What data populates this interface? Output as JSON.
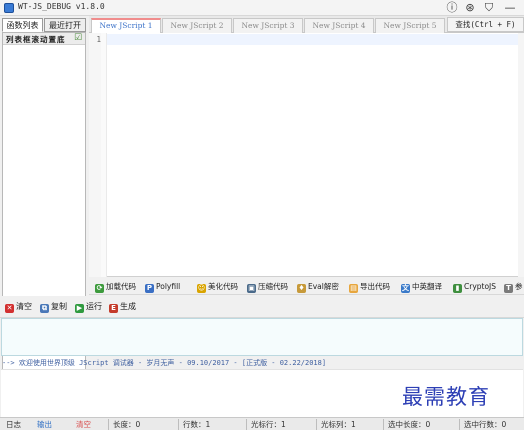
{
  "window": {
    "title": "WT-JS_DEBUG v1.8.0",
    "buttons": [
      "ⓘ",
      "⊛",
      "⛉",
      "—"
    ]
  },
  "left_panel": {
    "tabs": [
      "函数列表",
      "最近打开"
    ],
    "list_header": "列表框滚动置底",
    "list_header_check": "☑"
  },
  "script_tabs": [
    "New JScript 1",
    "New JScript 2",
    "New JScript 3",
    "New JScript 4",
    "New JScript 5"
  ],
  "find_button": "查找(Ctrl + F)",
  "editor": {
    "line_numbers": [
      "1"
    ]
  },
  "toolbar1": [
    {
      "label": "加载代码",
      "icon": "load-icon",
      "glyph": "⟳",
      "color": "#3c9a3c"
    },
    {
      "label": "Polyfill",
      "icon": "polyfill-icon",
      "glyph": "P",
      "color": "#3a6fc4"
    },
    {
      "label": "美化代码",
      "icon": "beautify-icon",
      "glyph": "☺",
      "color": "#d9a400"
    },
    {
      "label": "压缩代码",
      "icon": "compress-icon",
      "glyph": "▣",
      "color": "#4a6a8a"
    },
    {
      "label": "Eval解密",
      "icon": "eval-icon",
      "glyph": "♦",
      "color": "#c79a3a"
    },
    {
      "label": "导出代码",
      "icon": "export-icon",
      "glyph": "▤",
      "color": "#e7a63d"
    },
    {
      "label": "中英翻译",
      "icon": "translate-icon",
      "glyph": "文",
      "color": "#3a7ac9"
    },
    {
      "label": "CryptoJS",
      "icon": "cryptojs-icon",
      "glyph": "▮",
      "color": "#3f8f3f"
    },
    {
      "label": "参",
      "icon": "params-icon",
      "glyph": "T",
      "color": "#7a7a7a"
    }
  ],
  "toolbar2": [
    {
      "label": "清空",
      "icon": "clear-icon",
      "glyph": "✕",
      "color": "#d23030"
    },
    {
      "label": "复制",
      "icon": "copy-icon",
      "glyph": "⧉",
      "color": "#4a78b8"
    },
    {
      "label": "运行",
      "icon": "run-icon",
      "glyph": "▶",
      "color": "#2f9a3f"
    },
    {
      "label": "生成",
      "icon": "generate-icon",
      "glyph": "E",
      "color": "#c43a2a"
    }
  ],
  "output_message": "--> 欢迎使用世界顶级 JScript 调试器 - 岁月无声 - 09.10/2017 - [正式版 - 02.22/2018]",
  "watermark": "最需教育",
  "status_bar": {
    "tabs": [
      "日志",
      "输出",
      "清空"
    ],
    "fields": [
      "长度：0",
      "行数：1",
      "光标行：1",
      "光标列：1",
      "选中长度：0",
      "选中行数：0"
    ]
  }
}
